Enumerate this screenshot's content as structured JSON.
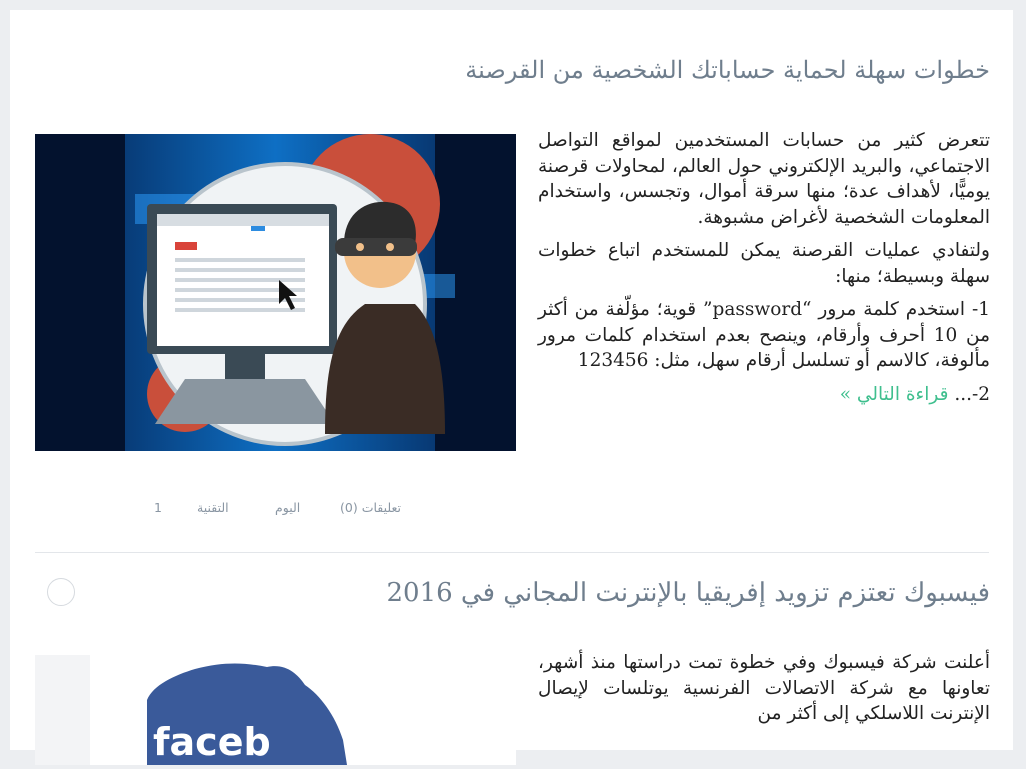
{
  "posts": [
    {
      "title": "خطوات سهلة لحماية حساباتك الشخصية من القرصنة",
      "image_icon": "hacker-at-computer-illustration",
      "paragraphs": [
        "تتعرض كثير من حسابات المستخدمين لمواقع التواصل الاجتماعي، والبريد الإلكتروني حول العالم، لمحاولات قرصنة يوميًّا، لأهداف عدة؛ منها سرقة أموال، وتجسس، واستخدام المعلومات الشخصية لأغراض مشبوهة.",
        "ولتفادي عمليات القرصنة يمكن للمستخدم اتباع خطوات سهلة وبسيطة؛ منها:",
        "1- استخدم كلمة مرور “password” قوية؛ مؤلّفة من أكثر من 10 أحرف وأرقام، وينصح بعدم استخدام كلمات مرور مألوفة، كالاسم أو تسلسل أرقام سهل، مثل: 123456"
      ],
      "last_line": "2-...",
      "read_more": "قراءة التالي »",
      "meta": {
        "comments": "تعليقات (0)",
        "date": "اليوم",
        "category": "التقنية",
        "count": "1"
      }
    },
    {
      "title": "فيسبوك تعتزم تزويد إفريقيا بالإنترنت المجاني في 2016",
      "image_icon": "facebook-africa-map",
      "paragraphs": [
        "أعلنت شركة فيسبوك وفي خطوة تمت دراستها منذ أشهر، تعاونها مع شركة الاتصالات الفرنسية يوتلسات لإيصال الإنترنت اللاسلكي إلى أكثر من"
      ]
    }
  ],
  "colors": {
    "background": "#eceef1",
    "card": "#ffffff",
    "title": "#6f7e8d",
    "link": "#3fbf8e",
    "meta": "#8a96a3"
  }
}
